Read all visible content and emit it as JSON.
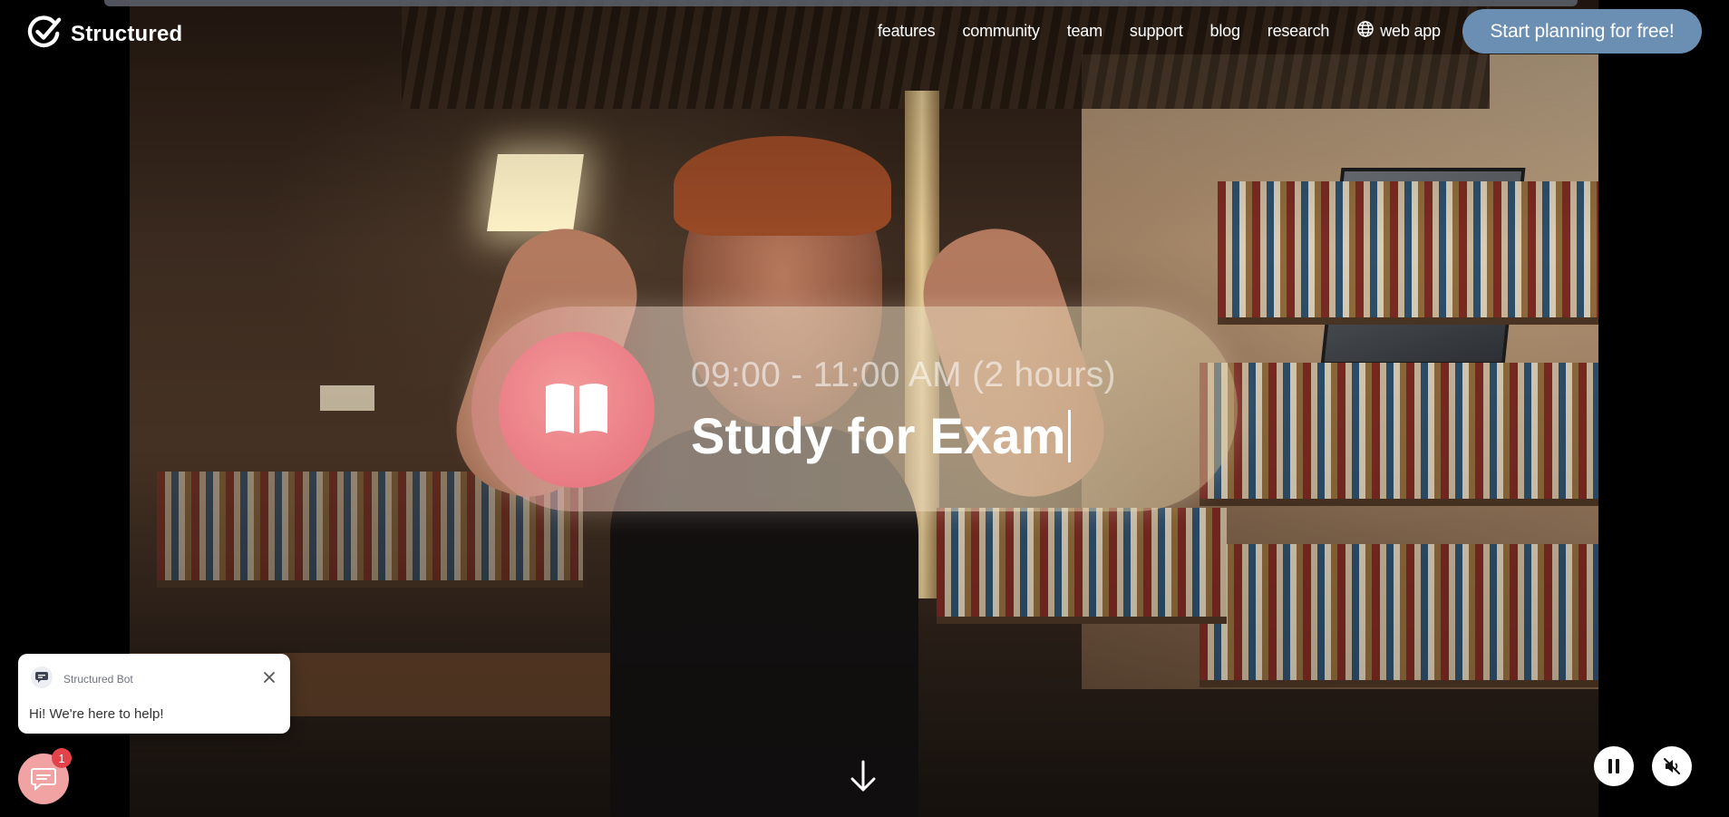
{
  "brand": {
    "name": "Structured",
    "logo_icon": "check-circle-icon"
  },
  "nav": {
    "items": [
      {
        "label": "features"
      },
      {
        "label": "community"
      },
      {
        "label": "team"
      },
      {
        "label": "support"
      },
      {
        "label": "blog"
      },
      {
        "label": "research"
      }
    ],
    "web_app": {
      "label": "web app",
      "icon": "globe-icon"
    }
  },
  "cta": {
    "label": "Start planning for free!"
  },
  "event": {
    "time": "09:00 - 11:00 AM (2 hours)",
    "title": "Study for Exam",
    "icon": "book-icon"
  },
  "chat": {
    "bot_name": "Structured Bot",
    "message": "Hi! We're here to help!",
    "unread_count": "1"
  },
  "controls": {
    "scroll_icon": "arrow-down-icon",
    "pause_icon": "pause-icon",
    "mute_icon": "muted-speaker-icon"
  },
  "colors": {
    "cta_bg": "#6b8fb3",
    "event_icon_bg": "#e97b84",
    "chat_launcher_bg": "#f1a3a3",
    "badge_bg": "#e2434b"
  }
}
